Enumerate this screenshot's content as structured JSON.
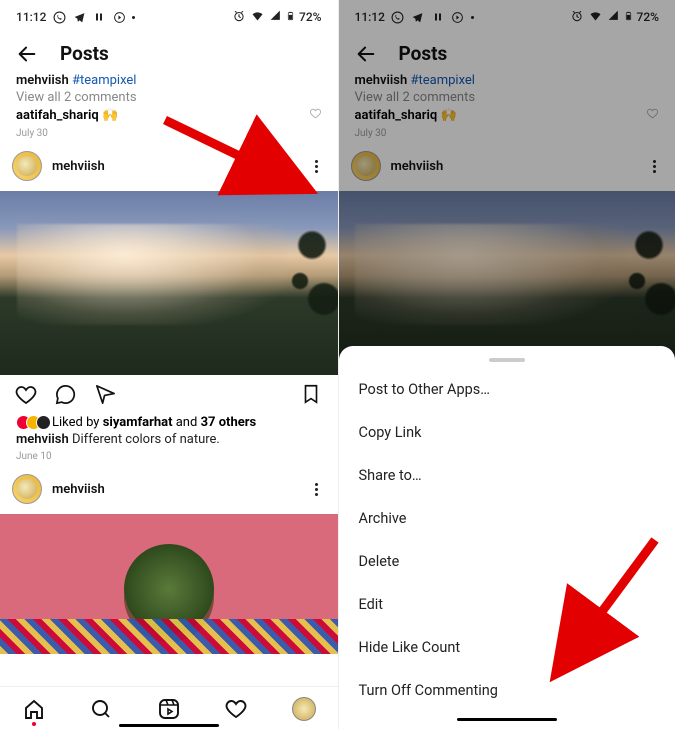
{
  "status": {
    "time": "11:12",
    "battery": "72%"
  },
  "header": {
    "title": "Posts"
  },
  "post1": {
    "user": "mehviish",
    "tag": "#teampixel",
    "view_comments": "View all 2 comments",
    "commenter": "aatifah_shariq",
    "comment_emoji": "🙌",
    "date": "July 30"
  },
  "post2": {
    "user": "mehviish",
    "liked_by_prefix": "Liked by",
    "liked_by_user": "siyamfarhat",
    "liked_by_middle": "and",
    "liked_by_count": "37 others",
    "caption_user": "mehviish",
    "caption_text": "Different colors of nature.",
    "date": "June 10"
  },
  "post3": {
    "user": "mehviish"
  },
  "sheet": {
    "items": [
      "Post to Other Apps…",
      "Copy Link",
      "Share to…",
      "Archive",
      "Delete",
      "Edit",
      "Hide Like Count",
      "Turn Off Commenting"
    ]
  }
}
